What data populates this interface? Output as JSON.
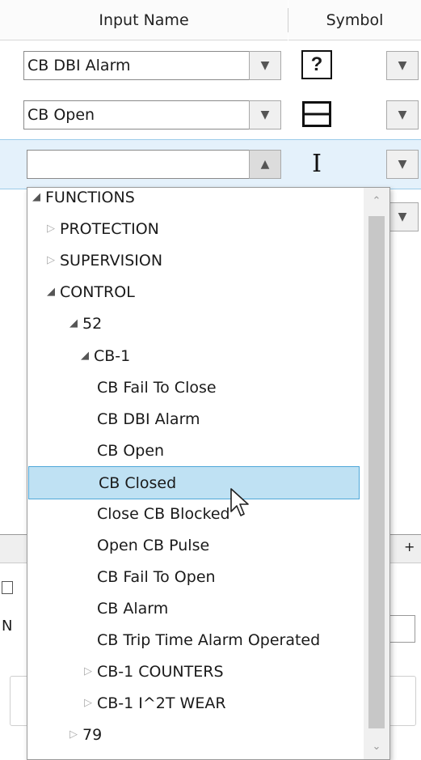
{
  "header": {
    "col_input_name": "Input Name",
    "col_symbol": "Symbol"
  },
  "rows": [
    {
      "input_name": "CB DBI Alarm",
      "symbol_icon": "question-symbol-icon"
    },
    {
      "input_name": "CB Open",
      "symbol_icon": "breaker-open-symbol-icon"
    },
    {
      "input_name": "",
      "symbol_icon": "text-cursor-symbol-icon"
    }
  ],
  "symbol_glyph": {
    "question": "?",
    "cursor": "I"
  },
  "tree": {
    "items": [
      {
        "label": "FUNCTIONS",
        "expander": "expanded"
      },
      {
        "label": "PROTECTION",
        "expander": "collapsed"
      },
      {
        "label": "SUPERVISION",
        "expander": "collapsed"
      },
      {
        "label": "CONTROL",
        "expander": "expanded"
      },
      {
        "label": "52",
        "expander": "expanded"
      },
      {
        "label": "CB-1",
        "expander": "expanded"
      },
      {
        "label": "CB Fail To Close"
      },
      {
        "label": "CB DBI Alarm"
      },
      {
        "label": "CB Open"
      },
      {
        "label": "CB Closed",
        "selected": true
      },
      {
        "label": "Close CB Blocked"
      },
      {
        "label": "Open CB Pulse"
      },
      {
        "label": "CB Fail To Open"
      },
      {
        "label": "CB Alarm"
      },
      {
        "label": "CB Trip Time Alarm Operated"
      },
      {
        "label": "CB-1 COUNTERS",
        "expander": "collapsed"
      },
      {
        "label": "CB-1 I^2T WEAR",
        "expander": "collapsed"
      },
      {
        "label": "79",
        "expander": "collapsed"
      }
    ]
  },
  "background_fragments": {
    "plus": "+",
    "left_char": "N"
  },
  "colors": {
    "selection_bg": "#bfe1f3",
    "selection_border": "#4fa7d8",
    "active_row": "#e4f1fb"
  }
}
